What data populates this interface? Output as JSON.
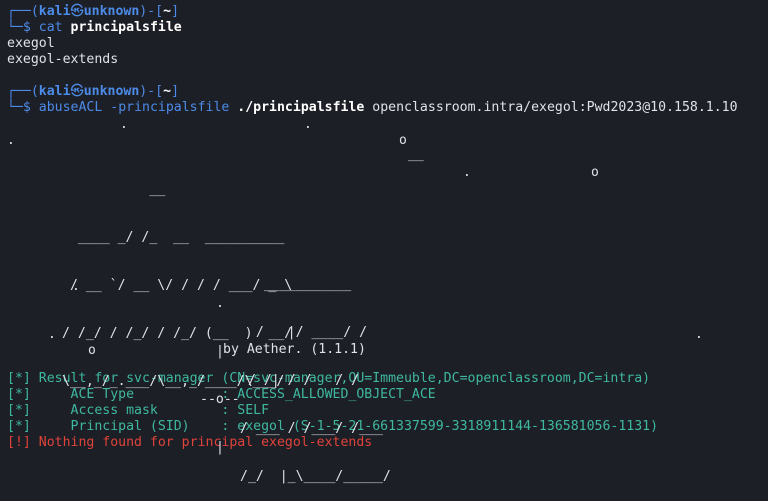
{
  "prompt1": {
    "top": "┌──(",
    "user": "kali",
    "at_symbol": "㉿",
    "host": "unknown",
    "mid": ")-[",
    "dir": "~",
    "end": "]",
    "bottom": "└─$ ",
    "cmd": "cat",
    "arg": "principalsfile"
  },
  "cat_output": [
    "exegol",
    "exegol-extends"
  ],
  "prompt2": {
    "top": "┌──(",
    "user": "kali",
    "at_symbol": "㉿",
    "host": "unknown",
    "mid": ")-[",
    "dir": "~",
    "end": "]",
    "bottom": "└─$ ",
    "cmd": "abuseACL",
    "flag": "-principalsfile",
    "path": "./principalsfile",
    "target": "openclassroom.intra/exegol:Pwd2023@10.158.1.10"
  },
  "banner": {
    "abuse_art": [
      "           __",
      "  ____ _/ /_  __  __________",
      " / __ `/ __ \\/ / / / ___/ _ \\",
      "/ /_/ / /_/ / /_/ (__  )  __/",
      "\\__,_/_.___/\\__,_/____/\\___/"
    ],
    "acl_art": [
      "   ___________",
      "  /   |/ ____/ /",
      " / /| / /   / /",
      "/ ___ / /___/ /___",
      "/_/  |_\\____/_____/"
    ],
    "compass": [
      ".",
      "|",
      "--o--",
      "|"
    ],
    "author": "by Aether. (1.1.1)",
    "decor": {
      "dot": ".",
      "circle": "o",
      "tick": "__"
    }
  },
  "results": [
    {
      "prefix": "[*]",
      "text": " Result for svc-manager (CN=svc-manager,OU=Immeuble,DC=openclassroom,DC=intra)",
      "level": "info"
    },
    {
      "prefix": "[*]",
      "text": "     ACE Type           : ACCESS_ALLOWED_OBJECT_ACE",
      "level": "info"
    },
    {
      "prefix": "[*]",
      "text": "     Access mask        : SELF",
      "level": "info"
    },
    {
      "prefix": "[*]",
      "text": "     Principal (SID)    : exegol (S-1-5-21-661337599-3318911144-136581056-1131)",
      "level": "info"
    },
    {
      "prefix": "[!]",
      "text": " Nothing found for principal exegol-extends",
      "level": "error"
    }
  ],
  "colors": {
    "background": "#1c1f26",
    "prompt_blue": "#4d8be8",
    "info_green": "#3fb8a0",
    "error_red": "#e0433b",
    "foreground": "#dfe2e7"
  }
}
